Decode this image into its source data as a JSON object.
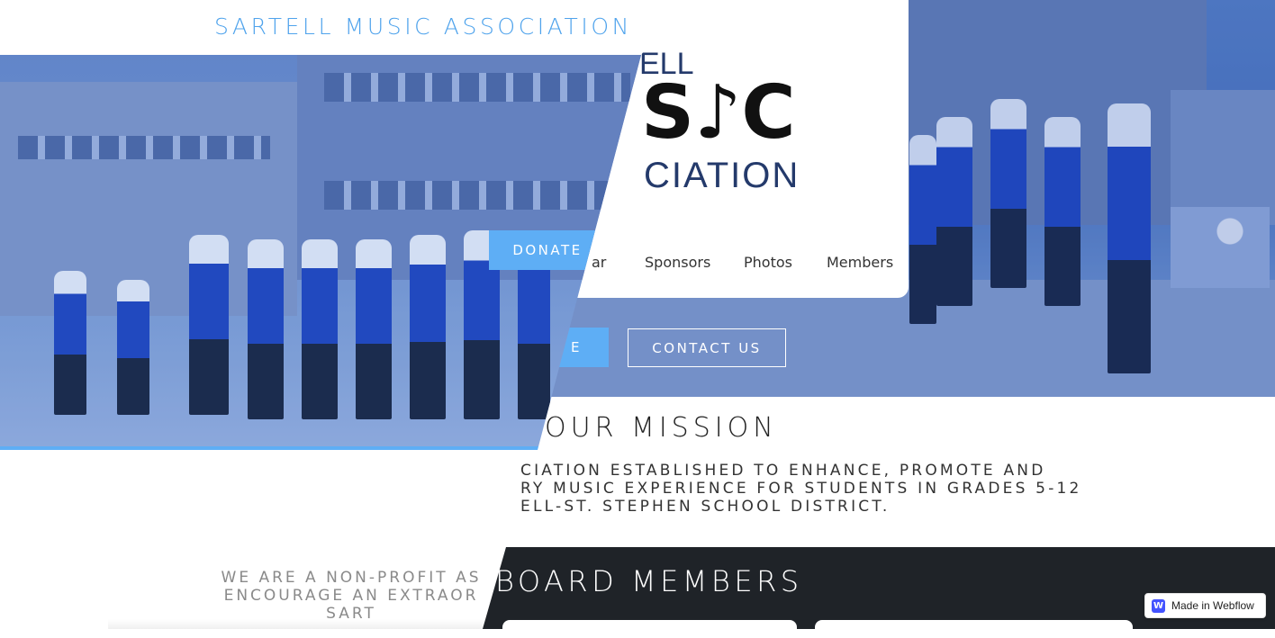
{
  "site": {
    "title": "SARTELL MUSIC ASSOCIATION"
  },
  "logo": {
    "line1": "ELL",
    "line2": "S♪C",
    "line3": "CIATION",
    "colors": {
      "navy": "#243a6b",
      "black": "#111111"
    }
  },
  "nav": {
    "items": [
      {
        "label": "ar"
      },
      {
        "label": "Sponsors"
      },
      {
        "label": "Photos"
      },
      {
        "label": "Members"
      }
    ]
  },
  "hero": {
    "donate_label": "DONATE",
    "partial_button_label": "E",
    "contact_label": "CONTACT US"
  },
  "mission": {
    "title": "OUR MISSION",
    "lines": [
      "CIATION ESTABLISHED TO ENHANCE, PROMOTE AND",
      "RY MUSIC EXPERIENCE FOR STUDENTS IN GRADES 5-12",
      "ELL-ST. STEPHEN SCHOOL DISTRICT."
    ]
  },
  "faded": {
    "lines": [
      "WE ARE A NON-PROFIT AS",
      "ENCOURAGE AN EXTRAOR",
      "SART"
    ]
  },
  "board": {
    "title": "BOARD MEMBERS"
  },
  "badge": {
    "icon": "webflow-icon",
    "icon_glyph": "W",
    "label": "Made in Webflow"
  },
  "colors": {
    "accent": "#5eaef5",
    "title_blue": "#4fa3ec",
    "dark_panel": "#1f2328",
    "webflow": "#4353ff"
  }
}
